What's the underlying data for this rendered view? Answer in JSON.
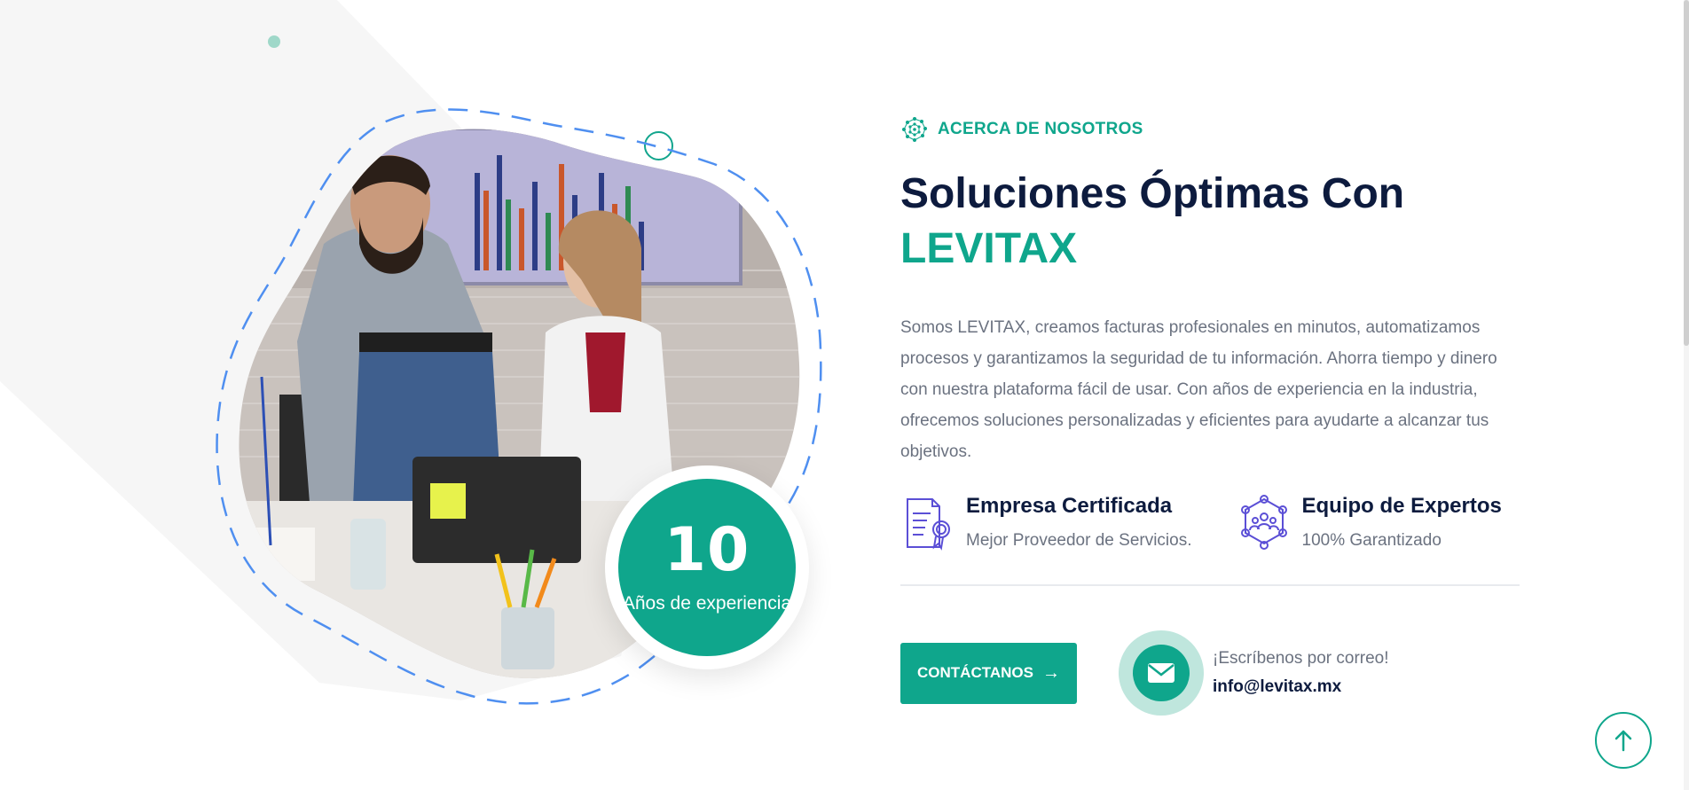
{
  "about": {
    "eyebrow": "ACERCA DE NOSOTROS",
    "title_line1": "Soluciones Óptimas Con",
    "title_line2": "LEVITAX",
    "description": "Somos LEVITAX, creamos facturas profesionales en minutos, automatizamos procesos y garantizamos la seguridad de tu información. Ahorra tiempo y dinero con nuestra plataforma fácil de usar. Con años de experiencia en la industria, ofrecemos soluciones personalizadas y eficientes para ayudarte a alcanzar tus objetivos."
  },
  "experience": {
    "years": "10",
    "label": "Años de experiencia"
  },
  "features": [
    {
      "title": "Empresa Certificada",
      "subtitle": "Mejor Proveedor de Servicios.",
      "icon": "certificate-icon"
    },
    {
      "title": "Equipo de Expertos",
      "subtitle": "100% Garantizado",
      "icon": "team-network-icon"
    }
  ],
  "cta": {
    "button_label": "CONTÁCTANOS",
    "button_icon": "arrow-right-icon"
  },
  "contact": {
    "label": "¡Escríbenos por correo!",
    "email": "info@levitax.mx",
    "icon": "envelope-icon"
  },
  "colors": {
    "accent": "#0fa68c",
    "heading": "#0d1b3e",
    "body_text": "#6b7280",
    "feature_icon": "#5b4fd6",
    "dashed_border": "#4f8ff0"
  }
}
